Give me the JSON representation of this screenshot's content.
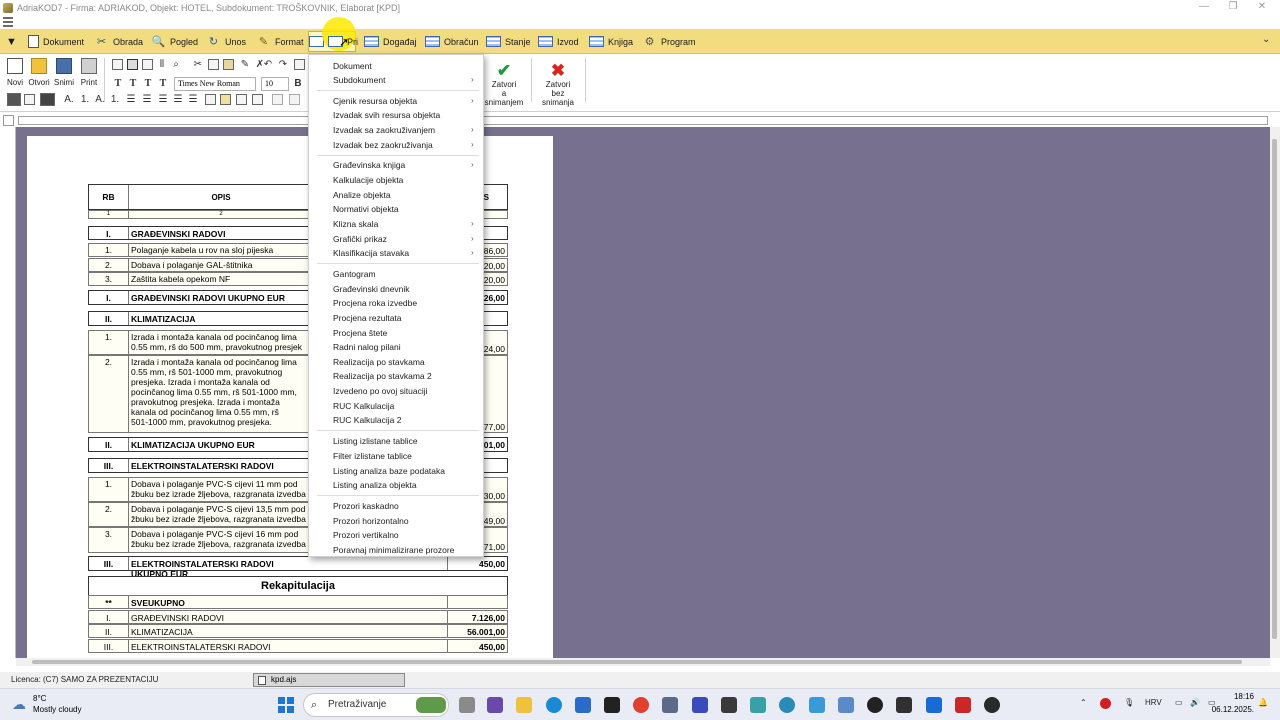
{
  "window": {
    "title": "AdriaKOD7 - Firma: ADRIAKOD,  Objekt: HOTEL,  Subdokument: TROŠKOVNIK,  Elaborat [KPD]"
  },
  "menubar": {
    "items": [
      "Dokument",
      "Obrada",
      "Pogled",
      "Unos",
      "Format",
      "Prikaz",
      "Događaj",
      "Obračun",
      "Stanje",
      "Izvod",
      "Knjiga",
      "Program"
    ],
    "active": "Prikaz",
    "active_partial_label": "Pri"
  },
  "toolbar": {
    "new": "Novi",
    "open": "Otvori",
    "save": "Snimi",
    "print": "Print",
    "font_name": "Times New Roman",
    "font_size": "10",
    "close_save_line1": "Zatvori",
    "close_save_line2": "a snimanjem",
    "close_nosave_line1": "Zatvori",
    "close_nosave_line2": "bez snimanja",
    "accent_green": "#1e9e3a",
    "accent_red": "#d9251c"
  },
  "table": {
    "headers": {
      "rb": "RB",
      "opis": "OPIS",
      "last": "S"
    },
    "subheaders": {
      "rb": "1",
      "opis": "2"
    },
    "rows": [
      {
        "rb": "I.",
        "desc": "GRAĐEVINSKI RADOVI",
        "amt": "",
        "type": "section"
      },
      {
        "rb": "1.",
        "desc": "Polaganje kabela u rov na sloj pijeska",
        "amt": "86,00",
        "type": "item"
      },
      {
        "rb": "2.",
        "desc": "Dobava i polaganje GAL-štitnika",
        "amt": "20,00",
        "type": "item"
      },
      {
        "rb": "3.",
        "desc": "Zaštita kabela opekom NF",
        "amt": "20,00",
        "type": "item"
      },
      {
        "rb": "I.",
        "desc": "GRAĐEVINSKI RADOVI UKUPNO EUR",
        "amt": "26,00",
        "type": "total"
      },
      {
        "rb": "II.",
        "desc": "KLIMATIZACIJA",
        "amt": "",
        "type": "section"
      },
      {
        "rb": "1.",
        "desc": "Izrada i montaža kanala od pocinčanog lima\n0.55 mm, rš do 500 mm, pravokutnog presjek",
        "amt": "24,00",
        "type": "item"
      },
      {
        "rb": "2.",
        "desc": "Izrada i montaža kanala od pocinčanog lima\n0.55 mm, rš 501-1000 mm, pravokutnog\npresjeka. Izrada i montaža kanala od\npocinčanog lima 0.55 mm, rš 501-1000 mm,\npravokutnog presjeka. Izrada i montaža\nkanala od pocinčanog lima 0.55 mm, rš\n501-1000 mm, pravokutnog presjeka.",
        "amt": "77,00",
        "type": "item"
      },
      {
        "rb": "II.",
        "desc": "KLIMATIZACIJA UKUPNO EUR",
        "amt": "01,00",
        "type": "total"
      },
      {
        "rb": "III.",
        "desc": "ELEKTROINSTALATERSKI RADOVI",
        "amt": "",
        "type": "section"
      },
      {
        "rb": "1.",
        "desc": "Dobava i polaganje PVC-S cijevi 11 mm pod\nžbuku bez izrade žljebova, razgranata izvedba",
        "amt": "30,00",
        "type": "item"
      },
      {
        "rb": "2.",
        "desc": "Dobava i polaganje PVC-S cijevi 13,5 mm pod\nžbuku bez izrade žljebova, razgranata izvedba",
        "amt": "49,00",
        "type": "item"
      },
      {
        "rb": "3.",
        "desc": "Dobava i polaganje PVC-S cijevi 16 mm pod\nžbuku bez izrade žljebova, razgranata izvedba",
        "amt": "71,00",
        "type": "item"
      },
      {
        "rb": "III.",
        "desc": "ELEKTROINSTALATERSKI RADOVI UKUPNO EUR",
        "amt": "450,00",
        "type": "total"
      }
    ],
    "recap_title": "Rekapitulacija",
    "recap_rows": [
      {
        "rb": "**",
        "desc": "SVEUKUPNO",
        "amt": ""
      },
      {
        "rb": "I.",
        "desc": "GRAĐEVINSKI RADOVI",
        "amt": "7.126,00"
      },
      {
        "rb": "II.",
        "desc": "KLIMATIZACIJA",
        "amt": "56.001,00"
      },
      {
        "rb": "III.",
        "desc": "ELEKTROINSTALATERSKI RADOVI",
        "amt": "450,00"
      }
    ]
  },
  "dropdown": {
    "items": [
      {
        "label": "Dokument",
        "arrow": false
      },
      {
        "label": "Subdokument",
        "arrow": true
      },
      {
        "label": "Cjenik resursa objekta",
        "arrow": true
      },
      {
        "label": "Izvadak svih resursa objekta",
        "arrow": false
      },
      {
        "label": "Izvadak sa zaokruživanjem",
        "arrow": true
      },
      {
        "label": "Izvadak bez zaokruživanja",
        "arrow": true
      },
      {
        "label": "Građevinska knjiga",
        "arrow": true
      },
      {
        "label": "Kalkulacije objekta",
        "arrow": false
      },
      {
        "label": "Analize objekta",
        "arrow": false
      },
      {
        "label": "Normativi objekta",
        "arrow": false
      },
      {
        "label": "Klizna skala",
        "arrow": true
      },
      {
        "label": "Grafički prikaz",
        "arrow": true
      },
      {
        "label": "Klasifikacija stavaka",
        "arrow": true
      },
      {
        "label": "Gantogram",
        "arrow": false
      },
      {
        "label": "Građevinski dnevnik",
        "arrow": false
      },
      {
        "label": "Procjena roka izvedbe",
        "arrow": false
      },
      {
        "label": "Procjena rezultata",
        "arrow": false
      },
      {
        "label": "Procjena štete",
        "arrow": false
      },
      {
        "label": "Radni nalog pilani",
        "arrow": false
      },
      {
        "label": "Realizacija po stavkama",
        "arrow": false
      },
      {
        "label": "Realizacija po stavkama 2",
        "arrow": false
      },
      {
        "label": "Izvedeno po ovoj situaciji",
        "arrow": false
      },
      {
        "label": "RUC Kalkulacija",
        "arrow": false
      },
      {
        "label": "RUC Kalkulacija 2",
        "arrow": false
      },
      {
        "label": "Listing izlistane tablice",
        "arrow": false
      },
      {
        "label": "Filter izlistane tablice",
        "arrow": false
      },
      {
        "label": "Listing analiza baze podataka",
        "arrow": false
      },
      {
        "label": "Listing analiza objekta",
        "arrow": false
      },
      {
        "label": "Prozori kaskadno",
        "arrow": false
      },
      {
        "label": "Prozori horizontalno",
        "arrow": false
      },
      {
        "label": "Prozori vertikalno",
        "arrow": false
      },
      {
        "label": "Poravnaj minimalizirane prozore",
        "arrow": false
      }
    ]
  },
  "statusbar": {
    "license": "Licenca:  (C7) SAMO ZA PREZENTACIJU",
    "file": "kpd.ajs"
  },
  "taskbar": {
    "weather_temp": "8°C",
    "weather_desc": "Mostly cloudy",
    "search_placeholder": "Pretraživanje",
    "language": "HRV",
    "time": "18:16",
    "date": "06.12.2025."
  },
  "colors": {
    "menubar_bg": "#f2dc80",
    "doc_bg": "#77708e",
    "highlight": "#ffe800"
  }
}
